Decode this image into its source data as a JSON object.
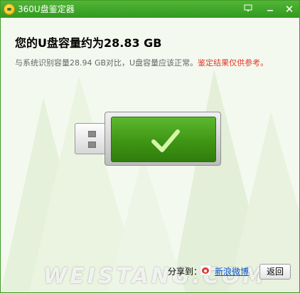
{
  "window": {
    "title": "360U盘鉴定器"
  },
  "titlebar": {
    "menu_icon": "menu-icon",
    "minimize_icon": "minimize-icon",
    "close_icon": "close-icon"
  },
  "result": {
    "headline": "您的U盘容量约为28.83 GB",
    "detail_prefix": "与系统识别容量28.94 GB对比，U盘容量应该正常。",
    "detail_warning": "鉴定结果仅供参考。"
  },
  "footer": {
    "share_label": "分享到：",
    "weibo_label": "新浪微博",
    "back_label": "返回",
    "watermark": "WEISTANG.COM"
  },
  "colors": {
    "accent": "#3c9a25",
    "warning": "#e03a2a",
    "link": "#0b55c9"
  }
}
